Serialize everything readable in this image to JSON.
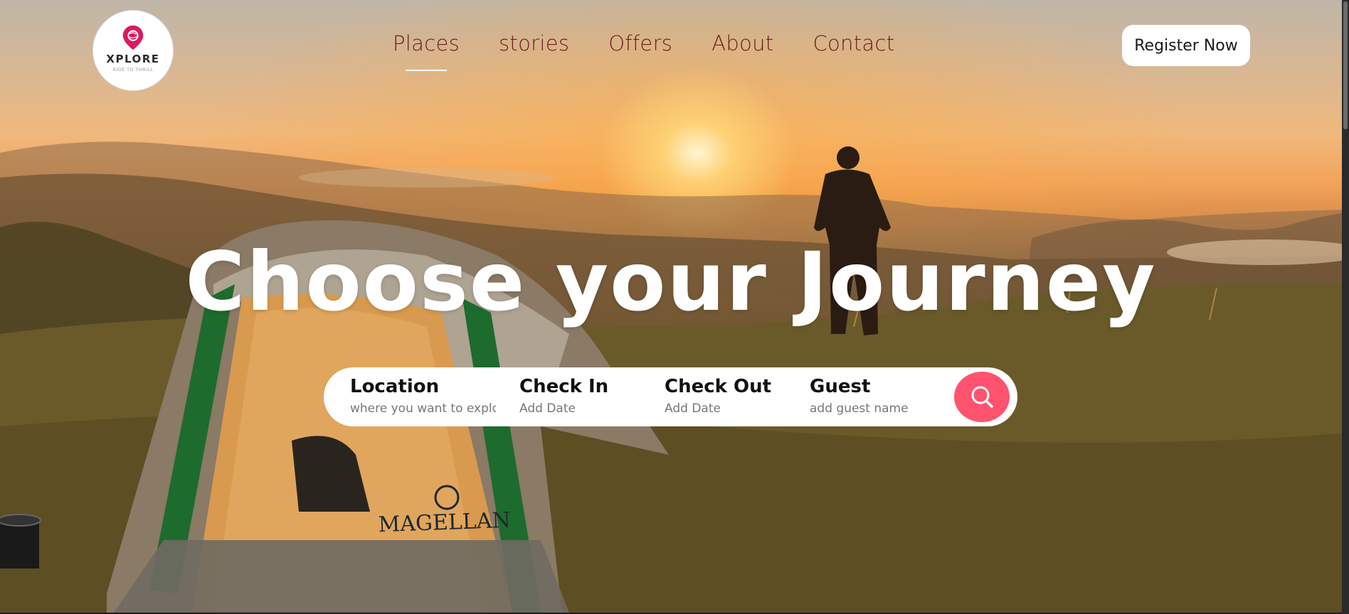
{
  "logo": {
    "title": "XPLORE",
    "tagline": "RIDE TO THRILL",
    "icon": "globe-pin-icon",
    "color": "#d81b60"
  },
  "nav": {
    "items": [
      {
        "label": "Places",
        "active": true
      },
      {
        "label": "stories",
        "active": false
      },
      {
        "label": "Offers",
        "active": false
      },
      {
        "label": "About",
        "active": false
      },
      {
        "label": "Contact",
        "active": false
      }
    ],
    "text_color": "#6b1d1d"
  },
  "header": {
    "register_label": "Register Now"
  },
  "hero": {
    "title": "Choose your Journey"
  },
  "search": {
    "location": {
      "label": "Location",
      "placeholder": "where you want to explore"
    },
    "check_in": {
      "label": "Check In",
      "placeholder": "Add Date"
    },
    "check_out": {
      "label": "Check Out",
      "placeholder": "Add Date"
    },
    "guest": {
      "label": "Guest",
      "placeholder": "add guest name"
    },
    "button_icon": "search-icon",
    "button_color": "#ff5370"
  }
}
